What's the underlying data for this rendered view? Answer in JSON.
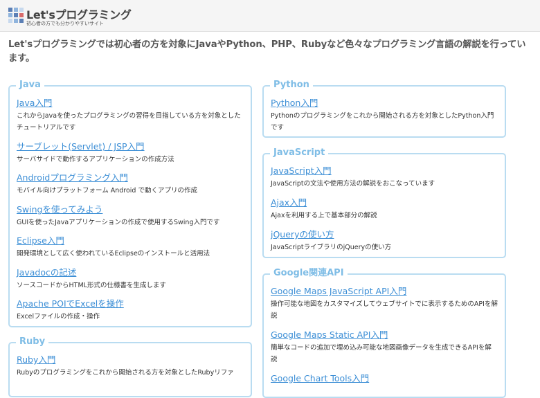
{
  "header": {
    "logo_title": "Let'sプログラミング",
    "logo_subtitle": "初心者の方でも分かりやすいサイト",
    "logo_icon": "grid-logo-icon",
    "logo_colors": [
      "#5b7fb5",
      "#8fb4dd",
      "#c7d9ee",
      "#d96b6b"
    ]
  },
  "intro": "Let'sプログラミングでは初心者の方を対象にJavaやPython、PHP、Rubyなど色々なプログラミング言語の解説を行っています。",
  "colors": {
    "link": "#3d8fd6",
    "section_border": "#b9dcf1",
    "section_title": "#7fbde6"
  },
  "sections": {
    "java": {
      "title": "Java",
      "items": [
        {
          "link": "Java入門",
          "desc": "これからJavaを使ったプログラミングの習得を目指している方を対象としたチュートリアルです"
        },
        {
          "link": "サーブレット(Servlet) / JSP入門",
          "desc": "サーバサイドで動作するアプリケーションの作成方法"
        },
        {
          "link": "Androidプログラミング入門",
          "desc": "モバイル向けプラットフォーム Android で動くアプリの作成"
        },
        {
          "link": "Swingを使ってみよう",
          "desc": "GUIを使ったJavaアプリケーションの作成で使用するSwing入門です"
        },
        {
          "link": "Eclipse入門",
          "desc": "開発環境として広く使われているEclipseのインストールと活用法"
        },
        {
          "link": "Javadocの記述",
          "desc": "ソースコードからHTML形式の仕様書を生成します"
        },
        {
          "link": "Apache POIでExcelを操作",
          "desc": "Excelファイルの作成・操作"
        }
      ]
    },
    "ruby": {
      "title": "Ruby",
      "items": [
        {
          "link": "Ruby入門",
          "desc": "Rubyのプログラミングをこれから開始される方を対象としたRubyリファ"
        }
      ]
    },
    "python": {
      "title": "Python",
      "items": [
        {
          "link": "Python入門",
          "desc": "Pythonのプログラミングをこれから開始される方を対象としたPython入門です"
        }
      ]
    },
    "javascript": {
      "title": "JavaScript",
      "items": [
        {
          "link": "JavaScript入門",
          "desc": "JavaScriptの文法や使用方法の解説をおこなっています"
        },
        {
          "link": "Ajax入門",
          "desc": "Ajaxを利用する上で基本部分の解説"
        },
        {
          "link": "jQueryの使い方",
          "desc": "JavaScriptライブラリのjQueryの使い方"
        }
      ]
    },
    "google": {
      "title": "Google関連API",
      "items": [
        {
          "link": "Google Maps JavaScript API入門",
          "desc": "操作可能な地図をカスタマイズしてウェブサイトでに表示するためのAPIを解説"
        },
        {
          "link": "Google Maps Static API入門",
          "desc": "簡単なコードの追加で埋め込み可能な地図画像データを生成できるAPIを解説"
        },
        {
          "link": "Google Chart Tools入門",
          "desc": ""
        }
      ]
    }
  }
}
